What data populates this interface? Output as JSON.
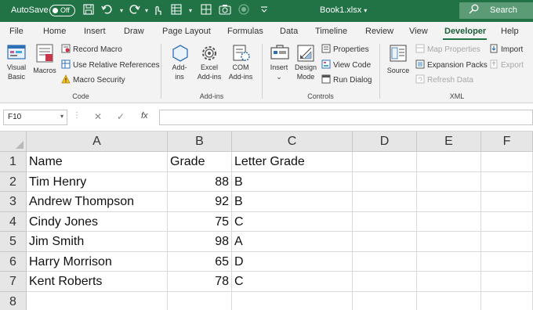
{
  "titlebar": {
    "autosave_label": "AutoSave",
    "autosave_state": "Off",
    "filename": "Book1.xlsx",
    "filename_chevron": "▾",
    "search_placeholder": "Search",
    "colors": {
      "bar": "#217346",
      "search_bg": "#5b9c76"
    }
  },
  "menu": {
    "tabs": [
      "File",
      "Home",
      "Insert",
      "Draw",
      "Page Layout",
      "Formulas",
      "Data",
      "Timeline",
      "Review",
      "View",
      "Developer",
      "Help"
    ],
    "active": "Developer"
  },
  "ribbon": {
    "code": {
      "title": "Code",
      "visual_basic": [
        "Visual",
        "Basic"
      ],
      "macros": "Macros",
      "record_macro": "Record Macro",
      "relative_refs": "Use Relative References",
      "macro_security": "Macro Security"
    },
    "addins": {
      "title": "Add-ins",
      "addins": [
        "Add-",
        "ins"
      ],
      "excel_addins": [
        "Excel",
        "Add-ins"
      ],
      "com_addins": [
        "COM",
        "Add-ins"
      ]
    },
    "controls": {
      "title": "Controls",
      "insert": "Insert",
      "insert_chevron": "⌄",
      "design_mode": [
        "Design",
        "Mode"
      ],
      "properties": "Properties",
      "view_code": "View Code",
      "run_dialog": "Run Dialog"
    },
    "xml": {
      "title": "XML",
      "source": "Source",
      "map_properties": "Map Properties",
      "expansion_packs": "Expansion Packs",
      "refresh_data": "Refresh Data",
      "import": "Import",
      "export": "Export"
    }
  },
  "formula_bar": {
    "name_box": "F10",
    "cancel_glyph": "✕",
    "enter_glyph": "✓",
    "fx_label": "fx",
    "formula": ""
  },
  "sheet": {
    "columns": [
      "A",
      "B",
      "C",
      "D",
      "E",
      "F"
    ],
    "rows": [
      {
        "n": "1",
        "cells": [
          "Name",
          "Grade",
          "Letter Grade"
        ]
      },
      {
        "n": "2",
        "cells": [
          "Tim Henry",
          "88",
          "B"
        ]
      },
      {
        "n": "3",
        "cells": [
          "Andrew Thompson",
          "92",
          "B"
        ]
      },
      {
        "n": "4",
        "cells": [
          "Cindy Jones",
          "75",
          "C"
        ]
      },
      {
        "n": "5",
        "cells": [
          "Jim Smith",
          "98",
          "A"
        ]
      },
      {
        "n": "6",
        "cells": [
          "Harry Morrison",
          "65",
          "D"
        ]
      },
      {
        "n": "7",
        "cells": [
          "Kent Roberts",
          "78",
          "C"
        ]
      },
      {
        "n": "8",
        "cells": [
          "",
          "",
          ""
        ]
      }
    ]
  }
}
